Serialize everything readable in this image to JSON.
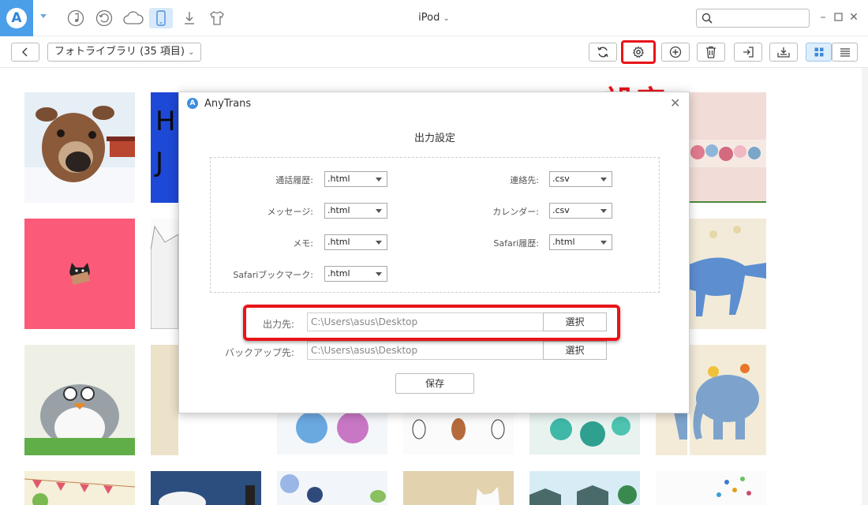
{
  "topbar": {
    "device_title": "iPod",
    "search_placeholder": "",
    "icons": [
      "music-icon",
      "history-icon",
      "cloud-icon",
      "device-icon",
      "download-icon",
      "tshirt-icon"
    ]
  },
  "toolbar": {
    "breadcrumb": "フォトライブラリ (35 項目)"
  },
  "annotation": {
    "settings_label": "設定"
  },
  "dialog": {
    "title": "AnyTrans",
    "heading": "出力設定",
    "fields": [
      {
        "label": "通話履歴:",
        "value": ".html"
      },
      {
        "label": "メッセージ:",
        "value": ".html"
      },
      {
        "label": "メモ:",
        "value": ".html"
      },
      {
        "label": "Safariブックマーク:",
        "value": ".html"
      },
      {
        "label": "連絡先:",
        "value": ".csv"
      },
      {
        "label": "カレンダー:",
        "value": ".csv"
      },
      {
        "label": "Safari履歴:",
        "value": ".html"
      }
    ],
    "output_label": "出力先:",
    "output_path": "C:\\Users\\asus\\Desktop",
    "backup_label": "バックアップ先:",
    "backup_path": "C:\\Users\\asus\\Desktop",
    "choose_label": "選択",
    "save_label": "保存"
  },
  "colors": {
    "accent": "#4a9fe8",
    "highlight": "#e8141a"
  }
}
